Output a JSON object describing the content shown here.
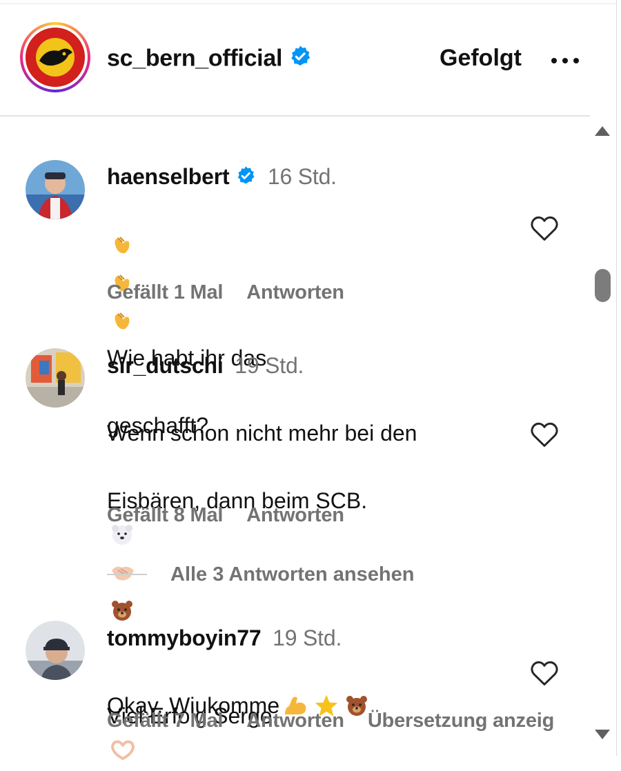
{
  "header": {
    "username": "sc_bern_official",
    "follow_label": "Gefolgt"
  },
  "comments": [
    {
      "username": "haenselbert",
      "verified": true,
      "time": "16 Std.",
      "text_line1": "Wie habt ihr das",
      "text_line2": "geschafft?",
      "likes": "Gefällt 1 Mal",
      "reply": "Antworten"
    },
    {
      "username": "sir_dutschi",
      "verified": false,
      "time": "19 Std.",
      "text_line1": "Wenn schon nicht mehr bei den",
      "text_line2": "Eisbären, dann beim SCB.",
      "text_line3": "Viel Erfolg Serge.",
      "likes": "Gefällt 8 Mal",
      "reply": "Antworten",
      "replies_label": "Alle 3 Antworten ansehen"
    },
    {
      "username": "tommyboyin77",
      "verified": false,
      "time": "19 Std.",
      "text_line1": "Okay. Wiukomme",
      "likes": "Gefällt 7 Mal",
      "reply": "Antworten",
      "translate": "Übersetzung anzeig"
    }
  ],
  "colors": {
    "accent_verified": "#0095f6",
    "muted": "#737373"
  },
  "icons": [
    "verified-badge-icon",
    "more-options-icon",
    "heart-icon",
    "clap-emoji-icon",
    "polar-bear-emoji-icon",
    "handshake-emoji-icon",
    "bear-emoji-icon",
    "heart-hands-emoji-icon",
    "flexed-biceps-emoji-icon",
    "star-emoji-icon"
  ]
}
